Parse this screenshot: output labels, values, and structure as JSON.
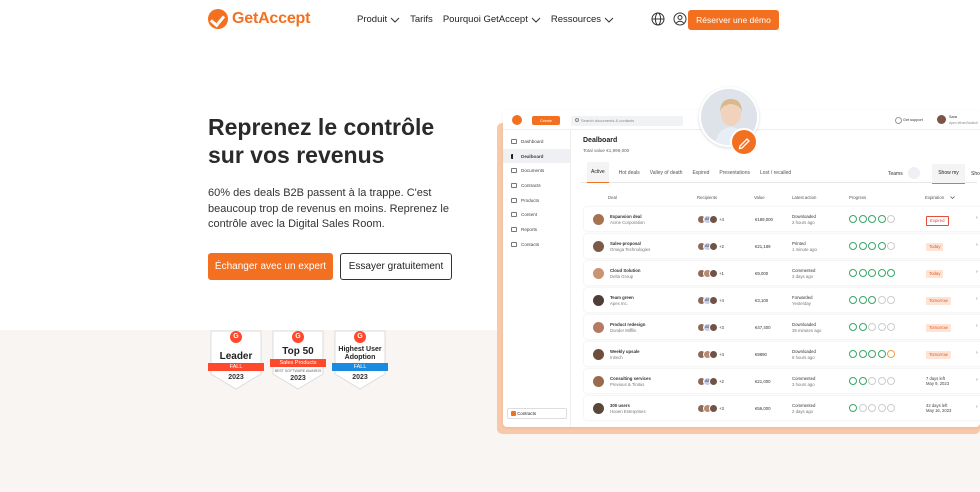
{
  "brand": {
    "name": "GetAccept",
    "accent": "#f37021"
  },
  "nav": {
    "items": [
      {
        "label": "Produit",
        "has_dropdown": true
      },
      {
        "label": "Tarifs",
        "has_dropdown": false
      },
      {
        "label": "Pourquoi GetAccept",
        "has_dropdown": true
      },
      {
        "label": "Ressources",
        "has_dropdown": true
      }
    ],
    "icons": [
      "globe-icon",
      "user-icon"
    ],
    "cta": "Réserver une démo"
  },
  "hero": {
    "title_line1": "Reprenez le contrôle",
    "title_line2": "sur vos revenus",
    "lead": "60% des deals B2B passent à la trappe. C'est beaucoup trop de revenus en moins. Reprenez le contrôle avec la Digital Sales Room.",
    "primary_cta": "Échanger avec un expert",
    "secondary_cta": "Essayer gratuitement"
  },
  "badges": [
    {
      "title": "Leader",
      "ribbon": "FALL",
      "year": "2023",
      "ribbon_color": "#ff492c"
    },
    {
      "title": "Top 50",
      "ribbon": "Sales Products",
      "sub": "BEST SOFTWARE AWARDS",
      "year": "2023",
      "ribbon_color": "#ff492c"
    },
    {
      "title": "Highest User Adoption",
      "ribbon": "FALL",
      "year": "2023",
      "ribbon_color": "#1a8be0"
    }
  ],
  "app": {
    "create_label": "Create",
    "search_placeholder": "Search documents & contacts",
    "get_support": "Get support",
    "user_name": "Sara",
    "user_company": "Apex #fromScratch",
    "sidebar": [
      "Dashboard",
      "Dealboard",
      "Documents",
      "Contracts",
      "Products",
      "Content",
      "Reports",
      "Contacts"
    ],
    "sidebar_bottom": "Contracts",
    "page_title": "Dealboard",
    "total_value": "Total value €1,999,000",
    "tabs": [
      "Active",
      "Hot deals",
      "Valley of death",
      "Expired",
      "Presentations",
      "Lost / recalled"
    ],
    "teams_label": "Teams",
    "show_my": "Show my",
    "show_cut": "Sho",
    "columns": [
      "Deal",
      "Recipients",
      "Value",
      "Latest action",
      "Progress",
      "Expiration"
    ],
    "rows": [
      {
        "deal": "Expansion deal",
        "company": "Acme Corporation",
        "rec": "AB",
        "more": "+4",
        "value": "€189,000",
        "action": "Downloaded",
        "when": "2 hours ago",
        "exp": "Expired",
        "exp_type": "red"
      },
      {
        "deal": "Sales-proposal",
        "company": "Omega Technologies",
        "rec": "AB",
        "more": "+2",
        "value": "€21,189",
        "action": "Printed",
        "when": "1 minute ago",
        "exp": "Today",
        "exp_type": "or"
      },
      {
        "deal": "Cloud Solution",
        "company": "Delta Group",
        "rec": "",
        "more": "+1",
        "value": "€9,000",
        "action": "Commented",
        "when": "3 days ago",
        "exp": "Today",
        "exp_type": "or"
      },
      {
        "deal": "Team green",
        "company": "Apex Inc.",
        "rec": "AB",
        "more": "+4",
        "value": "€3,100",
        "action": "Forwarded",
        "when": "Yesterday",
        "exp": "Tomorrow",
        "exp_type": "or"
      },
      {
        "deal": "Product redesign",
        "company": "Dunder Mifflin",
        "rec": "AB",
        "more": "+3",
        "value": "€47,400",
        "action": "Downloaded",
        "when": "39 minutes ago",
        "exp": "Tomorrow",
        "exp_type": "or"
      },
      {
        "deal": "Weekly upsale",
        "company": "Initech",
        "rec": "",
        "more": "+4",
        "value": "€9890",
        "action": "Downloaded",
        "when": "6 hours ago",
        "exp": "Tomorrow",
        "exp_type": "or"
      },
      {
        "deal": "Consulting services",
        "company": "Previous & Tinitus",
        "rec": "AB",
        "more": "+2",
        "value": "€21,000",
        "action": "Commented",
        "when": "3 hours ago",
        "exp": "7 days left\nMay 9, 2023",
        "exp_type": "text"
      },
      {
        "deal": "300 users",
        "company": "Hooen Enterprises",
        "rec": "",
        "more": "+3",
        "value": "€56,000",
        "action": "Commented",
        "when": "2 days ago",
        "exp": "42 days left\nMay 16, 2023",
        "exp_type": "text"
      }
    ]
  }
}
